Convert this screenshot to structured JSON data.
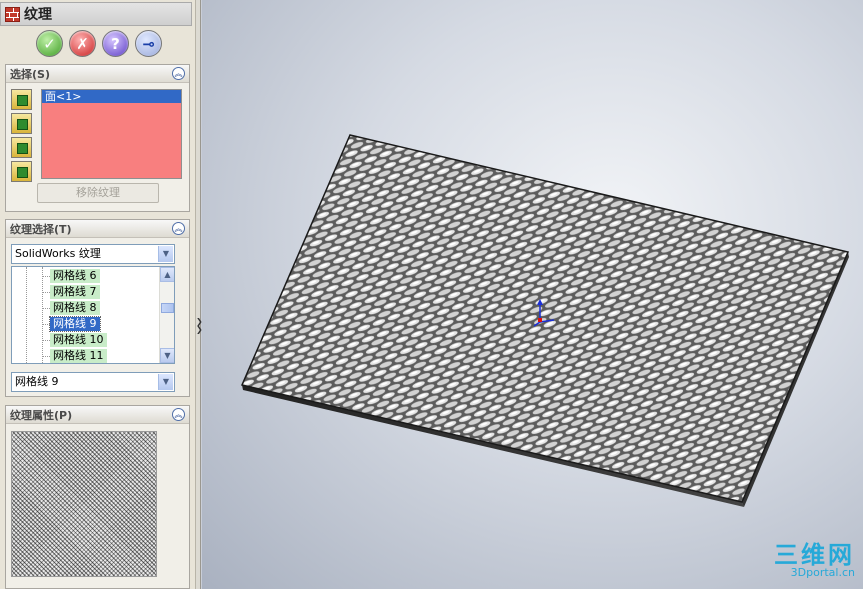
{
  "title": "纹理",
  "buttons": {
    "ok": "✓",
    "cancel": "✗",
    "help": "?",
    "pin": "⊸"
  },
  "selection": {
    "header": "选择(S)",
    "face": "面<1>",
    "remove_label": "移除纹理"
  },
  "texture_select": {
    "header": "纹理选择(T)",
    "library": "SolidWorks 纹理",
    "tree_items": [
      "网格线 6",
      "网格线 7",
      "网格线 8",
      "网格线 9",
      "网格线 10",
      "网格线 11"
    ],
    "selected_index": 3,
    "current": "网格线 9"
  },
  "texture_props": {
    "header": "纹理属性(P)"
  },
  "watermark": {
    "main": "三维网",
    "sub": "3Dportal.cn"
  },
  "colors": {
    "selection_list": "#f87f7f",
    "highlight": "#3169c6",
    "tree_item_bg": "#c8ecc8",
    "watermark": "#26a9d8"
  },
  "icons": [
    "brick-texture-icon",
    "ok-icon",
    "cancel-icon",
    "help-icon",
    "pin-icon",
    "collapse-icon",
    "chevron-down-icon"
  ]
}
